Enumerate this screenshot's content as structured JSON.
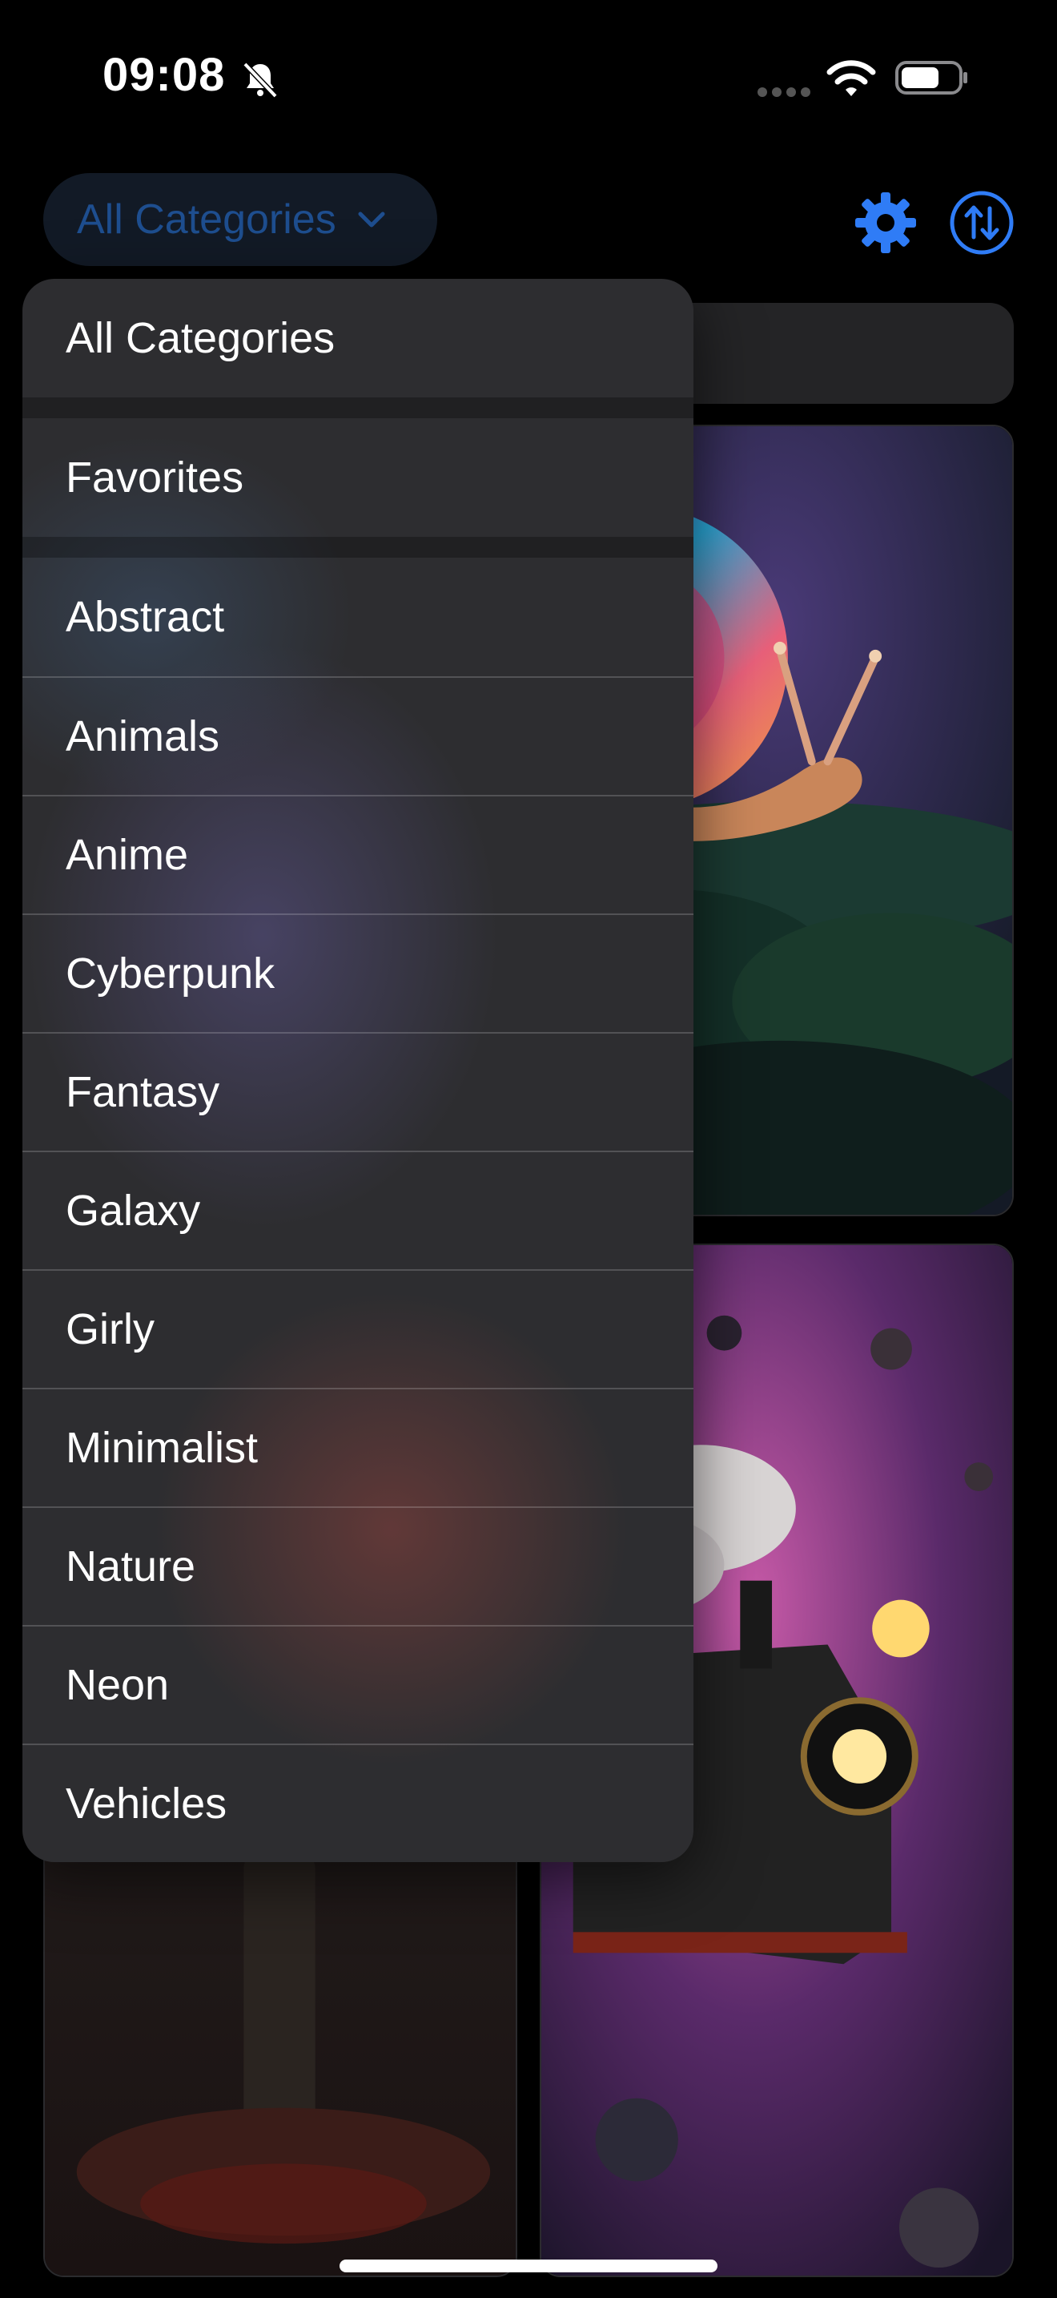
{
  "status_bar": {
    "time": "09:08",
    "icons": [
      "bell-slash-icon",
      "cellular-icon",
      "wifi-icon",
      "battery-icon"
    ]
  },
  "header": {
    "category_selector": {
      "label": "All Categories",
      "icon": "chevron-down-icon"
    },
    "buttons": [
      "gear-icon",
      "sort-icon"
    ]
  },
  "colors": {
    "accent": "#2f7cf6",
    "background": "#000000",
    "menu_background": "#2d2d30"
  },
  "category_menu": {
    "top_items": [
      "All Categories",
      "Favorites"
    ],
    "items": [
      "Abstract",
      "Animals",
      "Anime",
      "Cyberpunk",
      "Fantasy",
      "Galaxy",
      "Girly",
      "Minimalist",
      "Nature",
      "Neon",
      "Vehicles"
    ]
  },
  "wallpapers": [
    {
      "subject": "snail-wallpaper"
    },
    {
      "subject": "anchor-wallpaper"
    },
    {
      "subject": "space-train-wallpaper"
    }
  ]
}
